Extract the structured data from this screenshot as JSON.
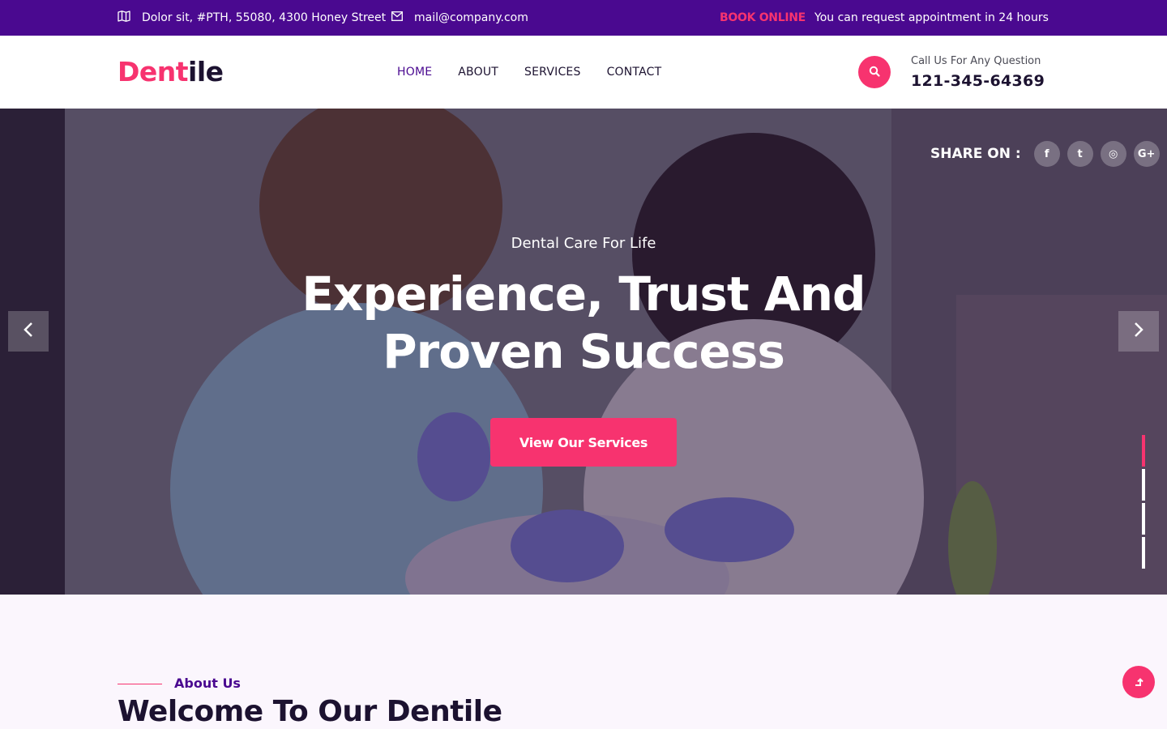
{
  "topbar": {
    "address": "Dolor sit, #PTH, 55080, 4300 Honey Street",
    "email": "mail@company.com",
    "book_online": "BOOK ONLINE",
    "appointment_note": "You can request appointment in 24 hours",
    "icons": [
      "map-icon",
      "envelope-icon"
    ]
  },
  "header": {
    "logo_part1": "Dent",
    "logo_part2": "ile",
    "nav": [
      {
        "label": "HOME",
        "active": true
      },
      {
        "label": "ABOUT",
        "active": false
      },
      {
        "label": "SERVICES",
        "active": false
      },
      {
        "label": "CONTACT",
        "active": false
      }
    ],
    "call_label": "Call Us For Any Question",
    "call_number": "121-345-64369"
  },
  "hero": {
    "share_label": "SHARE ON :",
    "social": [
      {
        "icon": "facebook-icon",
        "glyph": "f"
      },
      {
        "icon": "twitter-icon",
        "glyph": "t"
      },
      {
        "icon": "dribbble-icon",
        "glyph": "◎"
      },
      {
        "icon": "google-plus-icon",
        "glyph": "G+"
      }
    ],
    "subtitle": "Dental Care For Life",
    "title_line1": "Experience, Trust And",
    "title_line2": "Proven Success",
    "button_label": "View Our Services",
    "slides_total": 4,
    "active_slide": 1
  },
  "about": {
    "eyebrow": "About Us",
    "title": "Welcome To Our Dentile"
  },
  "colors": {
    "brand_purple": "#4a0990",
    "accent_pink": "#f7336f",
    "dark_text": "#1c1230"
  }
}
